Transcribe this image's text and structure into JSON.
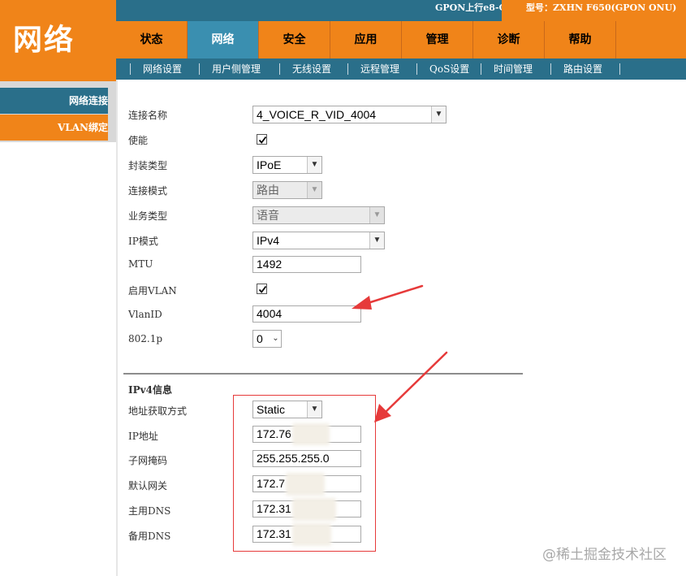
{
  "header": {
    "logo_text": "网络",
    "gpon_status": "GPON上行e8-C",
    "model": "型号：ZXHN F650(GPON ONU)",
    "colors": {
      "brand_orange": "#f08419",
      "nav_teal": "#2a6f8a",
      "active_tab": "#3a8fb0",
      "highlight_red": "#e63a3a"
    }
  },
  "nav": {
    "tabs": [
      {
        "label": "状态",
        "active": false
      },
      {
        "label": "网络",
        "active": true
      },
      {
        "label": "安全",
        "active": false
      },
      {
        "label": "应用",
        "active": false
      },
      {
        "label": "管理",
        "active": false
      },
      {
        "label": "诊断",
        "active": false
      },
      {
        "label": "帮助",
        "active": false
      }
    ],
    "sub_items": [
      {
        "label": "网络设置"
      },
      {
        "label": "用户侧管理"
      },
      {
        "label": "无线设置"
      },
      {
        "label": "远程管理"
      },
      {
        "label": "QoS设置"
      },
      {
        "label": "时间管理"
      },
      {
        "label": "路由设置"
      }
    ]
  },
  "sidebar": {
    "items": [
      {
        "label": "网络连接",
        "active": true
      },
      {
        "label": "VLAN绑定",
        "active": false
      }
    ]
  },
  "form": {
    "connection_name": {
      "label": "连接名称",
      "value": "4_VOICE_R_VID_4004"
    },
    "enable": {
      "label": "使能",
      "checked": true
    },
    "encap_type": {
      "label": "封装类型",
      "value": "IPoE"
    },
    "conn_mode": {
      "label": "连接模式",
      "value": "路由"
    },
    "service_type": {
      "label": "业务类型",
      "value": "语音"
    },
    "ip_mode": {
      "label": "IP模式",
      "value": "IPv4"
    },
    "mtu": {
      "label": "MTU",
      "value": "1492"
    },
    "enable_vlan": {
      "label": "启用VLAN",
      "checked": true
    },
    "vlan_id": {
      "label": "VlanID",
      "value": "4004"
    },
    "dot1p": {
      "label": "802.1p",
      "value": "0"
    }
  },
  "ipv4": {
    "section_title": "IPv4信息",
    "addr_method": {
      "label": "地址获取方式",
      "value": "Static"
    },
    "ip_address": {
      "label": "IP地址",
      "value": "172.76"
    },
    "subnet_mask": {
      "label": "子网掩码",
      "value": "255.255.255.0"
    },
    "gateway": {
      "label": "默认网关",
      "value": "172.7"
    },
    "primary_dns": {
      "label": "主用DNS",
      "value": "172.31"
    },
    "secondary_dns": {
      "label": "备用DNS",
      "value": "172.31"
    }
  },
  "watermark": "@稀土掘金技术社区"
}
